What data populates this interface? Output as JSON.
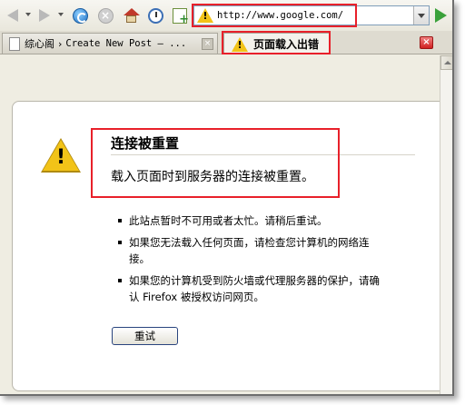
{
  "toolbar": {
    "url": "http://www.google.com/"
  },
  "tabs": [
    {
      "label_cn": "综心阁",
      "separator": "›",
      "label_rest": "Create New Post — ..."
    },
    {
      "label": "页面载入出错"
    }
  ],
  "error": {
    "title": "连接被重置",
    "description": "载入页面时到服务器的连接被重置。",
    "bullets": [
      "此站点暂时不可用或者太忙。请稍后重试。",
      "如果您无法载入任何页面，请检查您计算机的网络连接。",
      "如果您的计算机受到防火墙或代理服务器的保护，请确认 Firefox 被授权访问网页。"
    ],
    "retry_label": "重试"
  },
  "colors": {
    "highlight_box": "#e8202a",
    "warning_yellow": "#f2c318",
    "chrome_bg": "#efede2"
  }
}
